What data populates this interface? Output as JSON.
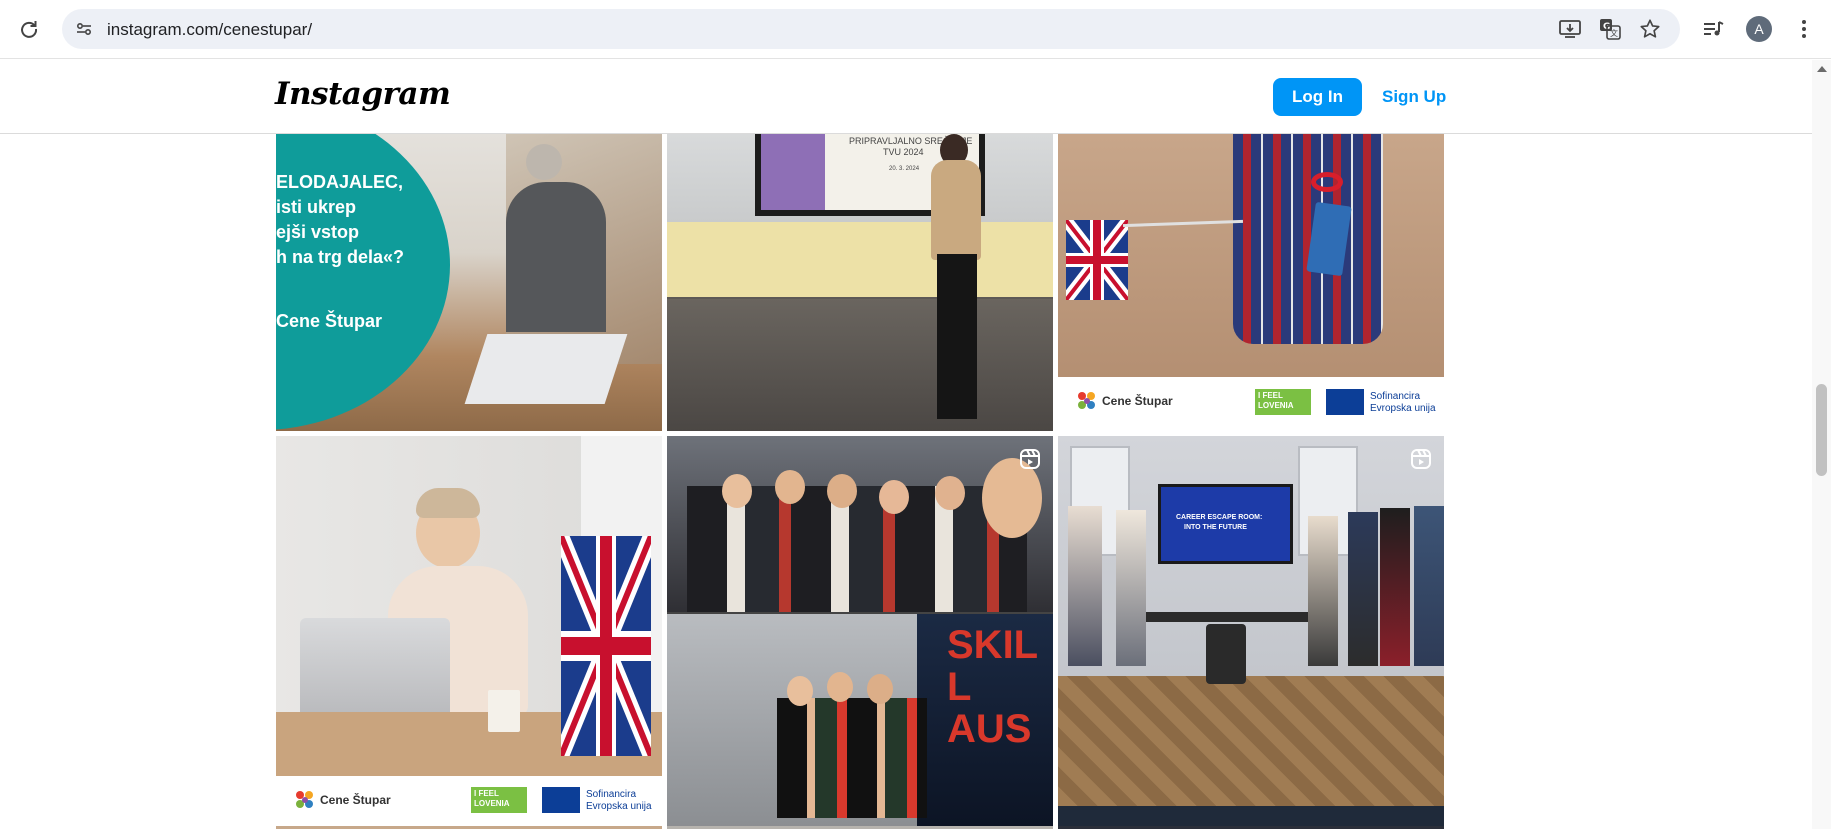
{
  "browser": {
    "url": "instagram.com/cenestupar/",
    "profile_initial": "A"
  },
  "header": {
    "logo": "Instagram",
    "login_label": "Log In",
    "signup_label": "Sign Up"
  },
  "posts": [
    {
      "lines": [
        "ELODAJALEC,",
        "isti ukrep",
        "ejši vstop",
        "h na trg dela«?"
      ],
      "brand": "Cene Štupar"
    },
    {
      "slide_title": "PRIPRAVLJALNO SREČANJE",
      "slide_sub": "TVU 2024",
      "slide_date": "20. 3. 2024"
    },
    {
      "brand": "Cene Štupar",
      "badge_line1": "I FEEL",
      "badge_line2": "LOVENIA",
      "eu_line1": "Sofinancira",
      "eu_line2": "Evropska unija"
    },
    {
      "brand": "Cene Štupar",
      "badge_line1": "I FEEL",
      "badge_line2": "LOVENIA",
      "eu_line1": "Sofinancira",
      "eu_line2": "Evropska unija"
    },
    {
      "sign_text": "SKILL AUS"
    },
    {
      "screen_line1": "CAREER ESCAPE ROOM:",
      "screen_line2": "INTO THE FUTURE"
    }
  ],
  "colors": {
    "accent": "#0095f6",
    "teal": "#0f9c9a"
  }
}
